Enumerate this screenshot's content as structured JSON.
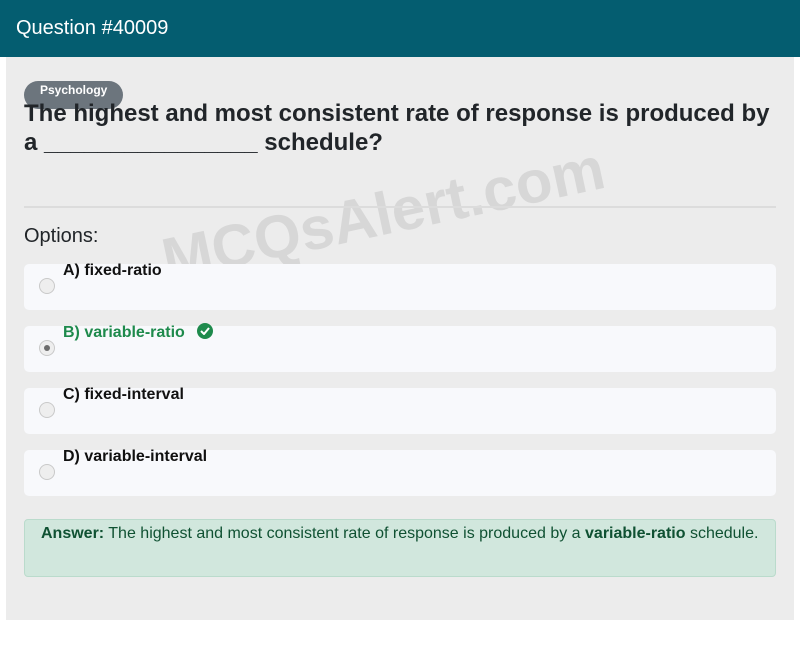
{
  "header": {
    "title": "Question #40009"
  },
  "question": {
    "category": "Psychology",
    "text": "The highest and most consistent rate of response is produced by a ________________ schedule?"
  },
  "watermark": "MCQsAlert.com",
  "options_label": "Options:",
  "options": [
    {
      "label": "A) fixed-ratio",
      "selected": false,
      "correct": false
    },
    {
      "label": "B) variable-ratio",
      "selected": true,
      "correct": true
    },
    {
      "label": "C) fixed-interval",
      "selected": false,
      "correct": false
    },
    {
      "label": "D) variable-interval",
      "selected": false,
      "correct": false
    }
  ],
  "answer": {
    "prefix": "Answer:",
    "before": "The highest and most consistent rate of response is produced by a",
    "highlight": "variable-ratio",
    "after": "schedule."
  },
  "colors": {
    "header_bg": "#045d70",
    "correct": "#1e8a4c",
    "answer_bg": "#d1e7dd"
  }
}
